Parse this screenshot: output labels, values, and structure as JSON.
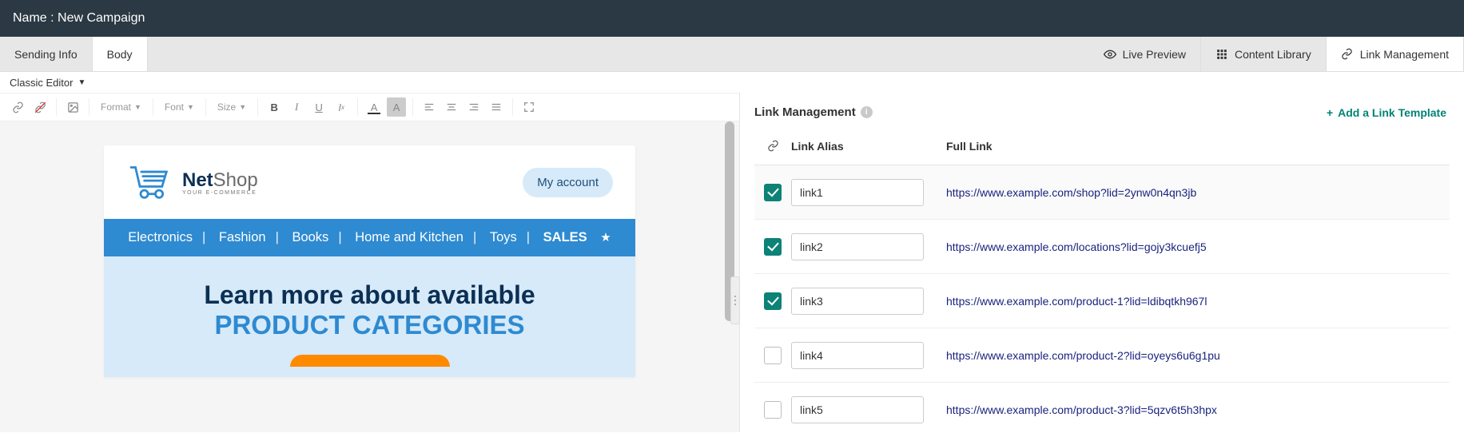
{
  "header": {
    "title": "Name : New Campaign"
  },
  "tabs": {
    "left": [
      {
        "label": "Sending Info",
        "active": false
      },
      {
        "label": "Body",
        "active": true
      }
    ],
    "right": [
      {
        "label": "Live Preview",
        "icon": "eye-icon"
      },
      {
        "label": "Content Library",
        "icon": "grid-icon"
      },
      {
        "label": "Link Management",
        "icon": "link-icon",
        "active": true
      }
    ]
  },
  "editor_mode": "Classic Editor",
  "toolbar": {
    "format_label": "Format",
    "font_label": "Font",
    "size_label": "Size"
  },
  "email_preview": {
    "brand_a": "Net",
    "brand_b": "Shop",
    "brand_tag": "Your E-Commerce",
    "account_btn": "My account",
    "nav": [
      "Electronics",
      "Fashion",
      "Books",
      "Home and Kitchen",
      "Toys"
    ],
    "nav_sales": "SALES",
    "hero_l1": "Learn more about available",
    "hero_l2": "PRODUCT CATEGORIES"
  },
  "right_panel": {
    "title": "Link Management",
    "add_text": "Add a Link Template",
    "columns": {
      "alias": "Link Alias",
      "url": "Full Link"
    },
    "rows": [
      {
        "checked": true,
        "alias": "link1",
        "url": "https://www.example.com/shop?lid=2ynw0n4qn3jb"
      },
      {
        "checked": true,
        "alias": "link2",
        "url": "https://www.example.com/locations?lid=gojy3kcuefj5"
      },
      {
        "checked": true,
        "alias": "link3",
        "url": "https://www.example.com/product-1?lid=ldibqtkh967l"
      },
      {
        "checked": false,
        "alias": "link4",
        "url": "https://www.example.com/product-2?lid=oyeys6u6g1pu"
      },
      {
        "checked": false,
        "alias": "link5",
        "url": "https://www.example.com/product-3?lid=5qzv6t5h3hpx"
      }
    ]
  }
}
